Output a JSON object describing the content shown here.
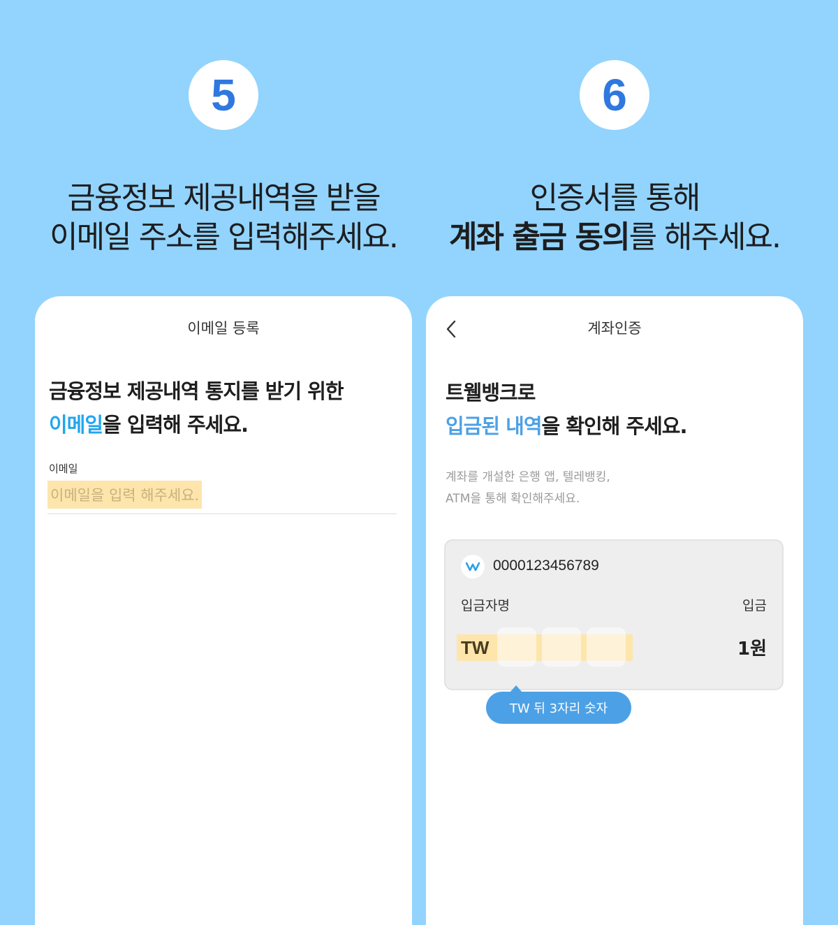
{
  "steps": [
    {
      "number": "5",
      "caption_line1": "금융정보 제공내역을 받을",
      "caption_line2": "이메일 주소를 입력해주세요."
    },
    {
      "number": "6",
      "caption_line1": "인증서를 통해",
      "caption_line2_bold": "계좌 출금 동의",
      "caption_line2_rest": "를 해주세요."
    }
  ],
  "email_screen": {
    "title": "이메일 등록",
    "headline_line1": "금융정보 제공내역 통지를 받기 위한",
    "headline_accent": "이메일",
    "headline_line2_rest": "을 입력해 주세요.",
    "field_label": "이메일",
    "placeholder": "이메일을 입력 해주세요.",
    "highlight_color": "#fde5ab"
  },
  "account_screen": {
    "title": "계좌인증",
    "back_icon": "chevron-left-icon",
    "headline_line1": "트웰뱅크로",
    "headline_accent": "입금된 내역",
    "headline_line2_rest": "을 확인해 주세요.",
    "subtext_line1": "계좌를 개설한 은행 앱, 텔레뱅킹,",
    "subtext_line2": "ATM을 통해 확인해주세요.",
    "bank_logo": "twelve-bank-logo",
    "account_number": "0000123456789",
    "depositor_label": "입금자명",
    "deposit_label": "입금",
    "depositor_prefix": "TW",
    "amount": "1원",
    "tooltip": "TW 뒤 3자리 숫자"
  },
  "colors": {
    "background": "#92d4fd",
    "step_number": "#2f78df",
    "accent": "#20a6ef",
    "tooltip": "#4ca1e6",
    "highlight": "#fde5ab"
  }
}
